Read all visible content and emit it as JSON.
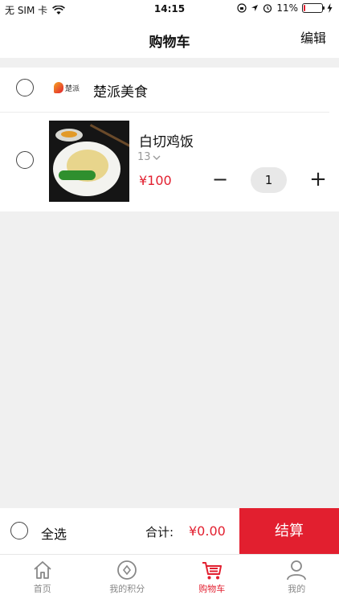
{
  "status": {
    "carrier": "无 SIM 卡",
    "time": "14:15",
    "battery": "11%",
    "battery_level": 0.11
  },
  "header": {
    "title": "购物车",
    "edit_label": "编辑"
  },
  "shop": {
    "name": "楚派美食",
    "logo_text": "楚派"
  },
  "item": {
    "name": "白切鸡饭",
    "spec": "13",
    "price": "¥100",
    "quantity": "1",
    "minus_label": "−",
    "plus_label": "+"
  },
  "footer": {
    "select_all_label": "全选",
    "total_label": "合计:",
    "total_value": "¥0.00",
    "checkout_label": "结算"
  },
  "tabs": [
    {
      "label": "首页",
      "icon": "home-icon",
      "active": false
    },
    {
      "label": "我的积分",
      "icon": "points-icon",
      "active": false
    },
    {
      "label": "购物车",
      "icon": "cart-icon",
      "active": true
    },
    {
      "label": "我的",
      "icon": "user-icon",
      "active": false
    }
  ],
  "colors": {
    "accent": "#e21f2f",
    "background": "#f0f0f0"
  }
}
